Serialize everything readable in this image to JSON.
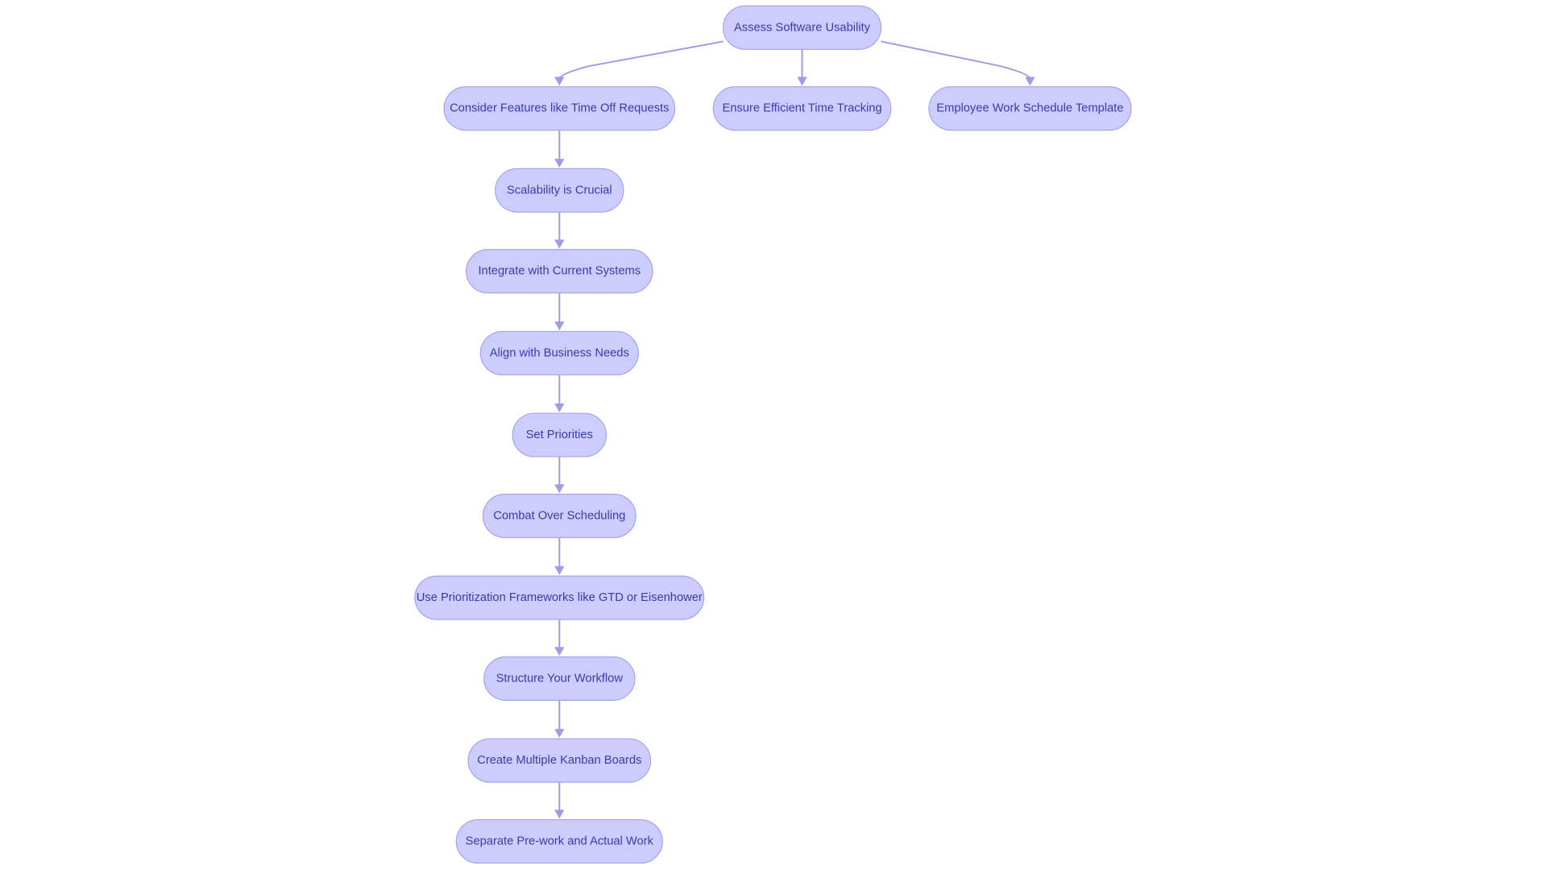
{
  "diagram": {
    "type": "flowchart",
    "colors": {
      "node_fill": "#ccccff",
      "node_border": "#a5a5ee",
      "text": "#3b3ba8",
      "edge": "#9c9ce8"
    },
    "nodes": [
      {
        "id": "root",
        "label": "Assess Software Usability"
      },
      {
        "id": "n1",
        "label": "Consider Features like Time Off Requests"
      },
      {
        "id": "n2",
        "label": "Ensure Efficient Time Tracking"
      },
      {
        "id": "n3",
        "label": "Employee Work Schedule Template"
      },
      {
        "id": "n4",
        "label": "Scalability is Crucial"
      },
      {
        "id": "n5",
        "label": "Integrate with Current Systems"
      },
      {
        "id": "n6",
        "label": "Align with Business Needs"
      },
      {
        "id": "n7",
        "label": "Set Priorities"
      },
      {
        "id": "n8",
        "label": "Combat Over Scheduling"
      },
      {
        "id": "n9",
        "label": "Use Prioritization Frameworks like GTD or Eisenhower"
      },
      {
        "id": "n10",
        "label": "Structure Your Workflow"
      },
      {
        "id": "n11",
        "label": "Create Multiple Kanban Boards"
      },
      {
        "id": "n12",
        "label": "Separate Pre-work and Actual Work"
      }
    ],
    "edges": [
      [
        "root",
        "n1"
      ],
      [
        "root",
        "n2"
      ],
      [
        "root",
        "n3"
      ],
      [
        "n1",
        "n4"
      ],
      [
        "n4",
        "n5"
      ],
      [
        "n5",
        "n6"
      ],
      [
        "n6",
        "n7"
      ],
      [
        "n7",
        "n8"
      ],
      [
        "n8",
        "n9"
      ],
      [
        "n9",
        "n10"
      ],
      [
        "n10",
        "n11"
      ],
      [
        "n11",
        "n12"
      ]
    ]
  }
}
